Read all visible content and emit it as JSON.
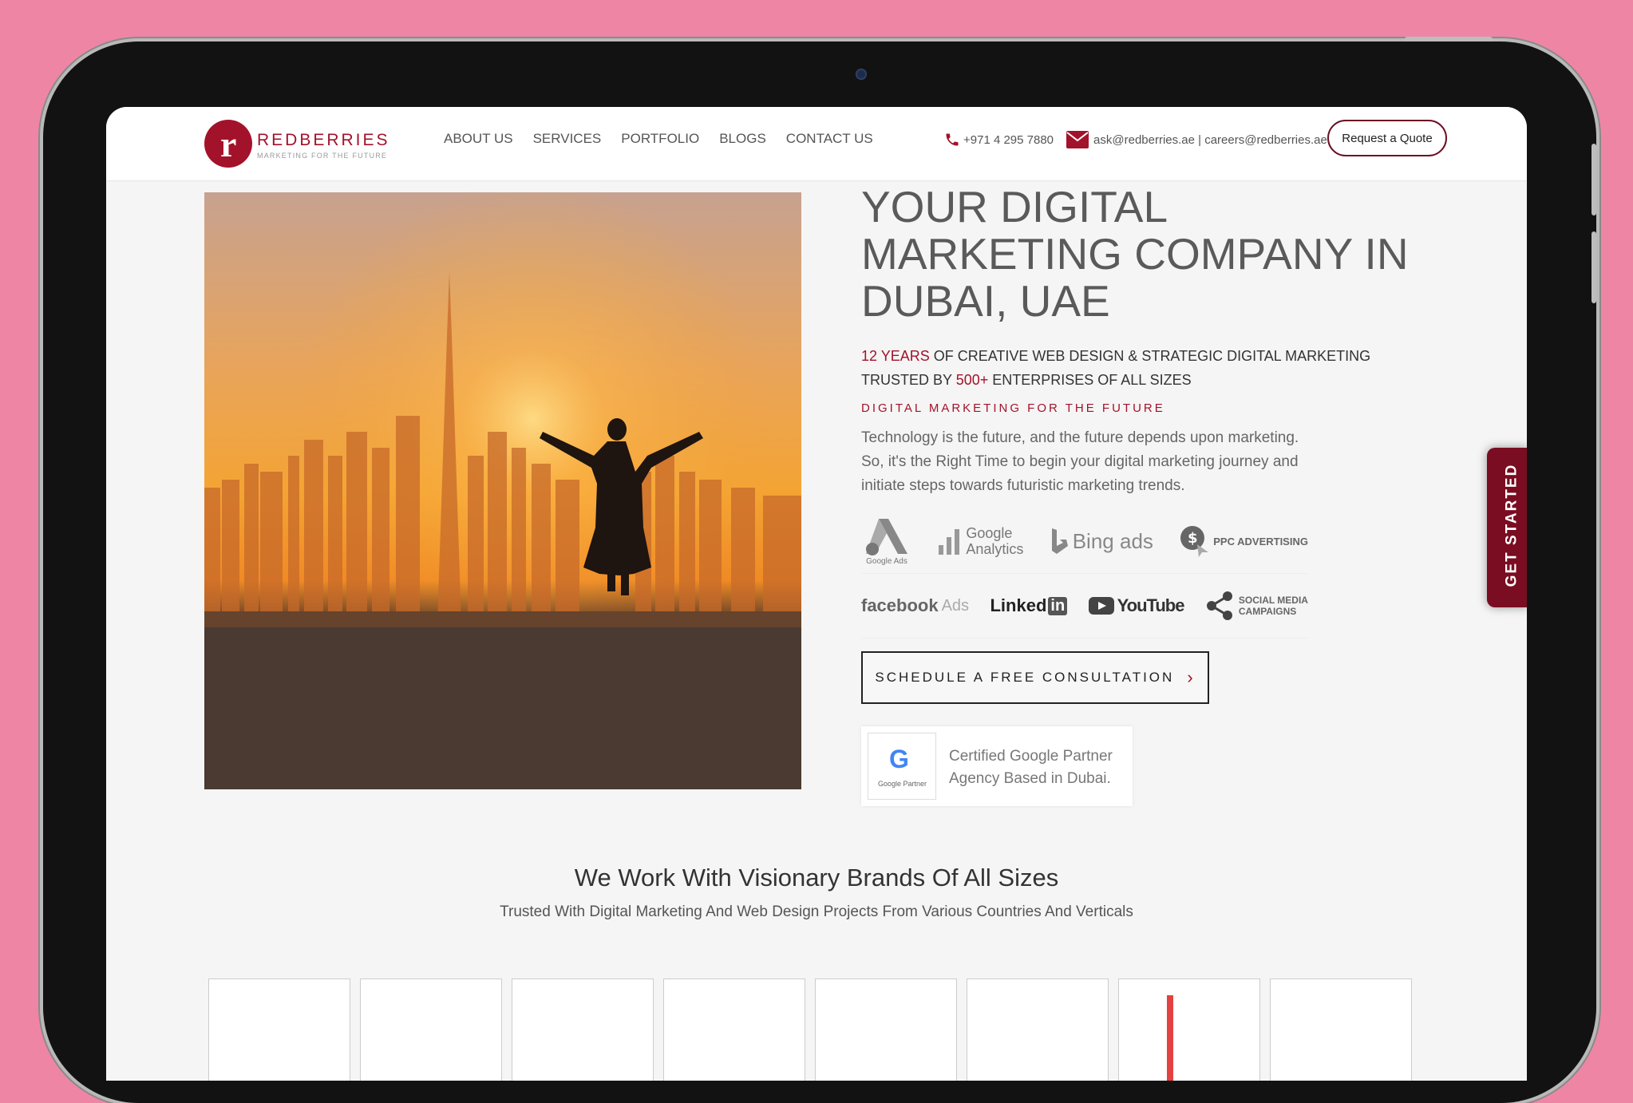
{
  "header": {
    "logo_name": "REDBERRIES",
    "logo_tagline": "MARKETING FOR THE FUTURE",
    "nav": [
      "ABOUT US",
      "SERVICES",
      "PORTFOLIO",
      "BLOGS",
      "CONTACT US"
    ],
    "phone": "+971 4 295 7880",
    "email": "ask@redberries.ae | careers@redberries.ae",
    "quote_button": "Request a Quote"
  },
  "hero": {
    "title": "YOUR DIGITAL MARKETING COMPANY IN DUBAI, UAE",
    "sub_years": "12 YEARS",
    "sub_text1": " OF CREATIVE WEB DESIGN & STRATEGIC DIGITAL MARKETING",
    "sub_trusted": "TRUSTED BY ",
    "sub_count": "500+",
    "sub_text2": " ENTERPRISES OF ALL SIZES",
    "tagline": "DIGITAL MARKETING FOR THE FUTURE",
    "description": "Technology is the future, and the future depends upon marketing. So, it's the Right Time to begin your digital marketing journey and initiate steps towards futuristic marketing trends.",
    "cta": "SCHEDULE A FREE CONSULTATION",
    "partner_badge_label": "Google Partner",
    "partner_text": "Certified Google Partner Agency Based in Dubai."
  },
  "platforms": {
    "google_ads": "Google Ads",
    "google_analytics_1": "Google",
    "google_analytics_2": "Analytics",
    "bing_ads": "Bing",
    "bing_ads_suffix": "ads",
    "ppc": "PPC ADVERTISING",
    "facebook": "facebook",
    "facebook_suffix": "Ads",
    "linkedin": "Linked",
    "linkedin_in": "in",
    "youtube": "YouTube",
    "social_1": "SOCIAL MEDIA",
    "social_2": "CAMPAIGNS"
  },
  "side_tab": "GET STARTED",
  "brands": {
    "title": "We Work With Visionary Brands Of All Sizes",
    "subtitle": "Trusted With Digital Marketing And Web Design Projects From Various Countries And Verticals"
  },
  "colors": {
    "brand_red": "#a3122b",
    "side_tab": "#7a0d21",
    "background": "#ef85a4"
  }
}
